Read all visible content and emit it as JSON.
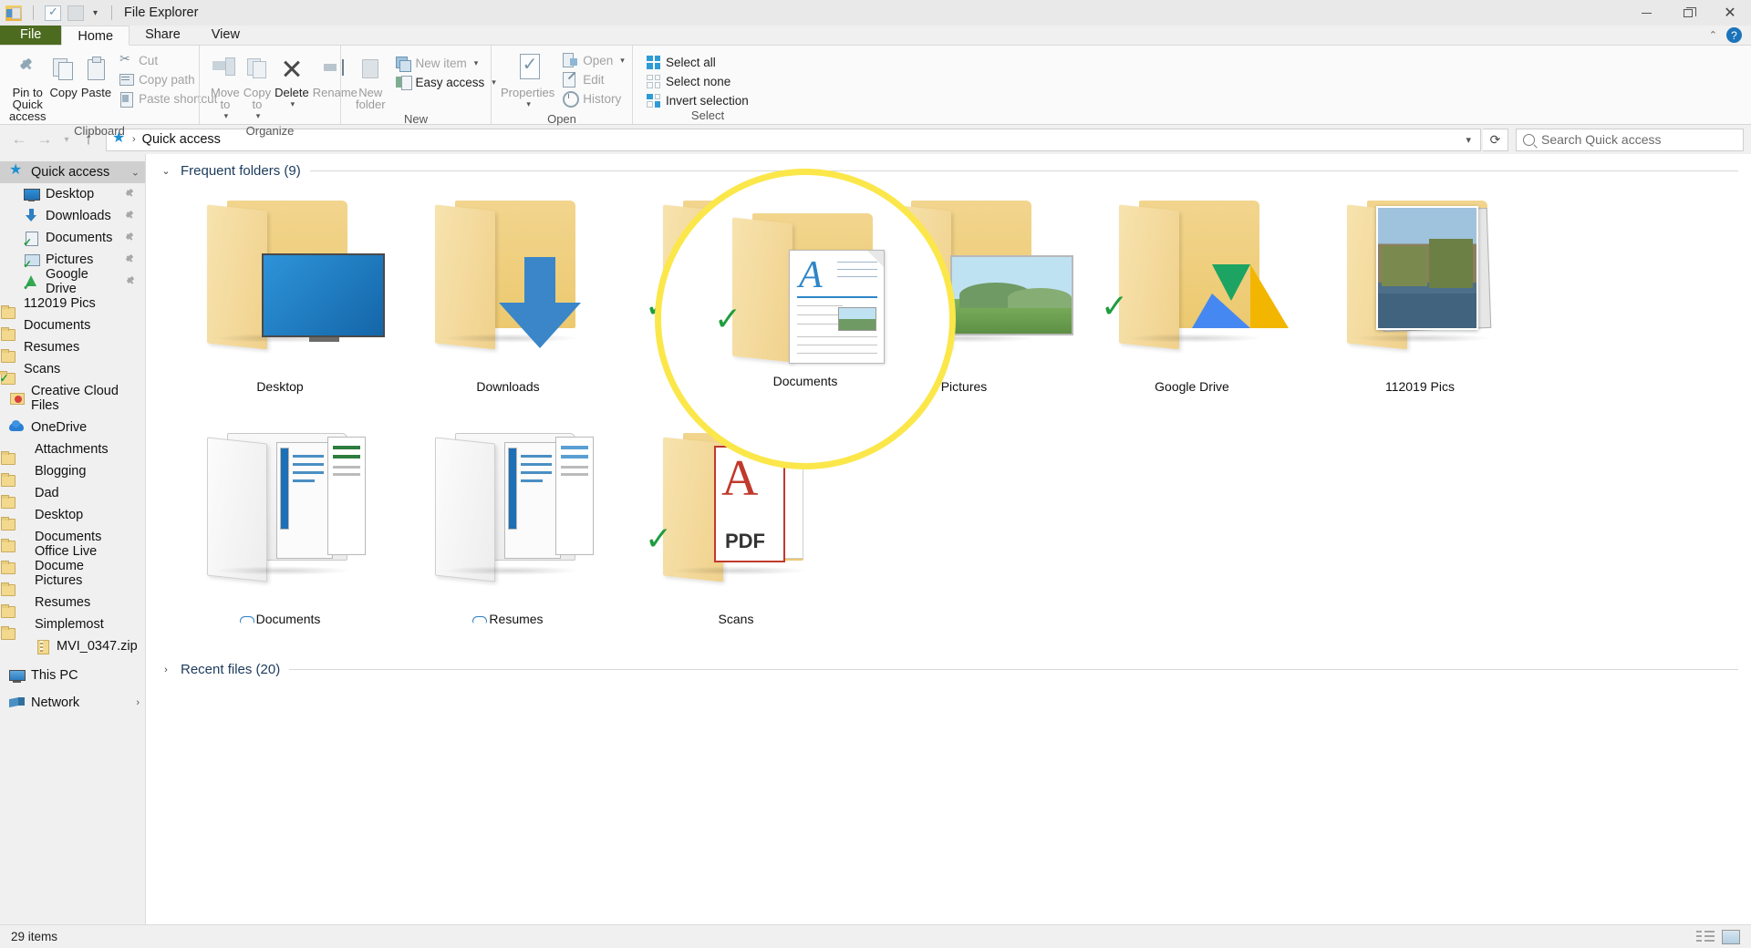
{
  "window": {
    "title": "File Explorer",
    "quick_access_toolbar": [
      "explorer-icon",
      "properties-icon",
      "new-folder-icon"
    ],
    "controls": {
      "minimize": "minimize-icon",
      "maximize": "maximize-icon",
      "close": "close-icon"
    },
    "help": "help-icon",
    "ribbon_collapse": "chevron-up-icon"
  },
  "tabs": [
    {
      "label": "File",
      "active": false,
      "style": "file"
    },
    {
      "label": "Home",
      "active": true
    },
    {
      "label": "Share",
      "active": false
    },
    {
      "label": "View",
      "active": false
    }
  ],
  "ribbon": {
    "groups": [
      {
        "label": "Clipboard",
        "big_buttons": [
          {
            "label": "Pin to Quick access",
            "icon": "pin-icon",
            "disabled": false
          },
          {
            "label": "Copy",
            "icon": "copy-icon",
            "disabled": false
          },
          {
            "label": "Paste",
            "icon": "paste-icon",
            "disabled": false
          }
        ],
        "small_buttons": [
          {
            "label": "Cut",
            "icon": "scissors-icon",
            "disabled": true
          },
          {
            "label": "Copy path",
            "icon": "copy-path-icon",
            "disabled": true
          },
          {
            "label": "Paste shortcut",
            "icon": "paste-shortcut-icon",
            "disabled": true
          }
        ]
      },
      {
        "label": "Organize",
        "big_buttons": [
          {
            "label": "Move to",
            "icon": "move-to-icon",
            "disabled": true,
            "dropdown": true
          },
          {
            "label": "Copy to",
            "icon": "copy-to-icon",
            "disabled": true,
            "dropdown": true
          },
          {
            "label": "Delete",
            "icon": "delete-icon",
            "disabled": false,
            "dropdown": true
          },
          {
            "label": "Rename",
            "icon": "rename-icon",
            "disabled": true
          }
        ],
        "small_buttons": []
      },
      {
        "label": "New",
        "big_buttons": [
          {
            "label": "New folder",
            "icon": "new-folder-icon",
            "disabled": true
          }
        ],
        "small_buttons": [
          {
            "label": "New item",
            "icon": "new-item-icon",
            "disabled": true,
            "dropdown": true
          },
          {
            "label": "Easy access",
            "icon": "easy-access-icon",
            "disabled": false,
            "dropdown": true
          }
        ]
      },
      {
        "label": "Open",
        "big_buttons": [
          {
            "label": "Properties",
            "icon": "properties-icon",
            "disabled": true,
            "dropdown": true
          }
        ],
        "small_buttons": [
          {
            "label": "Open",
            "icon": "open-icon",
            "disabled": true,
            "dropdown": true
          },
          {
            "label": "Edit",
            "icon": "edit-icon",
            "disabled": true
          },
          {
            "label": "History",
            "icon": "history-icon",
            "disabled": true
          }
        ]
      },
      {
        "label": "Select",
        "big_buttons": [],
        "small_buttons": [
          {
            "label": "Select all",
            "icon": "select-all-icon",
            "disabled": false
          },
          {
            "label": "Select none",
            "icon": "select-none-icon",
            "disabled": false
          },
          {
            "label": "Invert selection",
            "icon": "invert-selection-icon",
            "disabled": false
          }
        ]
      }
    ]
  },
  "addressbar": {
    "back": "back-arrow-icon",
    "forward": "forward-arrow-icon",
    "recent": "chevron-down-icon",
    "up": "up-arrow-icon",
    "path_icon": "quick-access-star-icon",
    "path": "Quick access",
    "dropdown": "chevron-down-icon",
    "refresh": "refresh-icon"
  },
  "search": {
    "placeholder": "Search Quick access",
    "icon": "search-icon"
  },
  "sidebar": {
    "items": [
      {
        "label": "Quick access",
        "icon": "star-icon",
        "selected": true,
        "indent": 0
      },
      {
        "label": "Desktop",
        "icon": "desktop-icon",
        "pinned": true,
        "indent": 1
      },
      {
        "label": "Downloads",
        "icon": "downloads-icon",
        "pinned": true,
        "indent": 1
      },
      {
        "label": "Documents",
        "icon": "documents-icon",
        "pinned": true,
        "indent": 1
      },
      {
        "label": "Pictures",
        "icon": "pictures-icon",
        "pinned": true,
        "indent": 1
      },
      {
        "label": "Google Drive",
        "icon": "google-drive-icon",
        "pinned": true,
        "indent": 1
      },
      {
        "label": "112019 Pics",
        "icon": "folder-icon",
        "indent": 1
      },
      {
        "label": "Documents",
        "icon": "folder-icon",
        "indent": 1
      },
      {
        "label": "Resumes",
        "icon": "folder-icon",
        "indent": 1
      },
      {
        "label": "Scans",
        "icon": "folder-synced-icon",
        "indent": 1
      },
      {
        "label": "Creative Cloud Files",
        "icon": "creative-cloud-icon",
        "indent": 0,
        "spacer_before": true
      },
      {
        "label": "OneDrive",
        "icon": "onedrive-icon",
        "indent": 0,
        "spacer_before": true
      },
      {
        "label": "Attachments",
        "icon": "folder-icon",
        "indent": 1
      },
      {
        "label": "Blogging",
        "icon": "folder-icon",
        "indent": 1
      },
      {
        "label": "Dad",
        "icon": "folder-icon",
        "indent": 1
      },
      {
        "label": "Desktop",
        "icon": "folder-icon",
        "indent": 1
      },
      {
        "label": "Documents",
        "icon": "folder-icon",
        "indent": 1
      },
      {
        "label": "Office Live Docume",
        "icon": "folder-icon",
        "indent": 1
      },
      {
        "label": "Pictures",
        "icon": "folder-icon",
        "indent": 1
      },
      {
        "label": "Resumes",
        "icon": "folder-icon",
        "indent": 1
      },
      {
        "label": "Simplemost",
        "icon": "folder-icon",
        "indent": 1
      },
      {
        "label": "MVI_0347.zip",
        "icon": "zip-icon",
        "indent": 1
      },
      {
        "label": "This PC",
        "icon": "this-pc-icon",
        "indent": 0,
        "spacer_before": true
      },
      {
        "label": "Network",
        "icon": "network-icon",
        "indent": 0,
        "spacer_before": true
      }
    ]
  },
  "content": {
    "sections": [
      {
        "title": "Frequent folders (9)",
        "expanded": true,
        "chevron": "chevron-down-icon"
      },
      {
        "title": "Recent files (20)",
        "expanded": false,
        "chevron": "chevron-right-icon"
      }
    ],
    "frequent_folders": [
      {
        "name": "Desktop",
        "art": "monitor",
        "checked": false,
        "cloud": false
      },
      {
        "name": "Downloads",
        "art": "arrow",
        "checked": false,
        "cloud": false
      },
      {
        "name": "Documents",
        "art": "document",
        "checked": true,
        "cloud": false,
        "highlighted": true
      },
      {
        "name": "Pictures",
        "art": "landscape",
        "checked": true,
        "cloud": false
      },
      {
        "name": "Google Drive",
        "art": "gdrive",
        "checked": true,
        "cloud": false
      },
      {
        "name": "112019 Pics",
        "art": "photos",
        "checked": false,
        "cloud": false
      },
      {
        "name": "Documents",
        "art": "docstack",
        "checked": false,
        "cloud": true
      },
      {
        "name": "Resumes",
        "art": "docstack",
        "checked": false,
        "cloud": true
      },
      {
        "name": "Scans",
        "art": "pdf",
        "checked": true,
        "cloud": false
      }
    ]
  },
  "statusbar": {
    "item_count": "29 items",
    "view_details": "details-view-icon",
    "view_large": "large-icons-view-icon"
  },
  "colors": {
    "accent_yellow": "#fbe74a",
    "folder": "#f0d18c",
    "check_green": "#1f9d3f",
    "file_tab_green": "#4d6b1f",
    "link_blue": "#1b3a5c"
  }
}
